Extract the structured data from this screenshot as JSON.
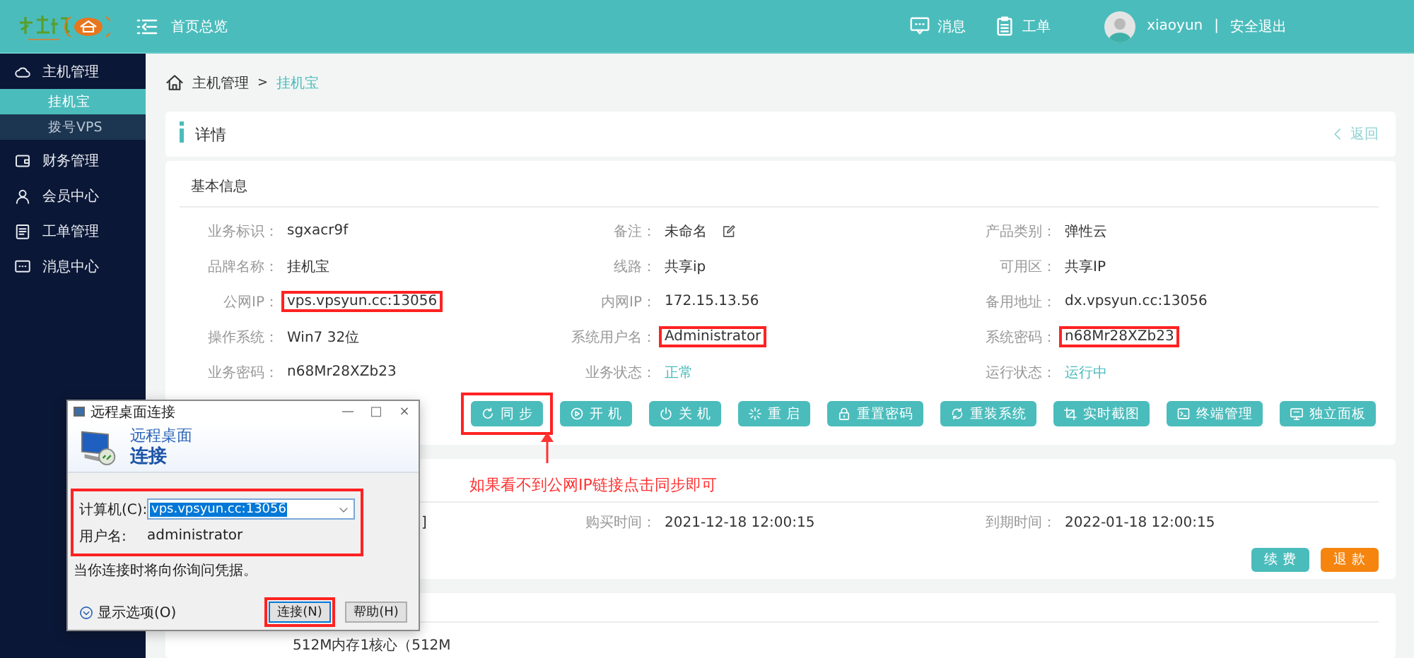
{
  "header": {
    "page_title": "首页总览",
    "links": [
      {
        "label": "消息"
      },
      {
        "label": "工单"
      }
    ],
    "user": "xiaoyun",
    "separator": "|",
    "logout": "安全退出"
  },
  "sidebar": {
    "items": [
      {
        "label": "主机管理",
        "children": [
          {
            "label": "挂机宝",
            "selected": true
          },
          {
            "label": "拨号VPS",
            "selected": false
          }
        ]
      },
      {
        "label": "财务管理"
      },
      {
        "label": "会员中心"
      },
      {
        "label": "工单管理"
      },
      {
        "label": "消息中心"
      }
    ]
  },
  "breadcrumb": {
    "items": [
      "主机管理",
      "挂机宝"
    ],
    "separator": ">"
  },
  "detail_header": {
    "title": "详情",
    "back": "返回"
  },
  "info": {
    "section_title": "基本信息",
    "fields": [
      {
        "label": "业务标识：",
        "value": "sgxacr9f",
        "kind": "text",
        "highlighted": false
      },
      {
        "label": "备注：",
        "value": "未命名",
        "kind": "editable",
        "highlighted": false
      },
      {
        "label": "产品类别：",
        "value": "弹性云",
        "kind": "text",
        "highlighted": false
      },
      {
        "label": "品牌名称：",
        "value": "挂机宝",
        "kind": "text",
        "highlighted": false
      },
      {
        "label": "线路：",
        "value": "共享ip",
        "kind": "text",
        "highlighted": false
      },
      {
        "label": "可用区：",
        "value": "共享IP",
        "kind": "text",
        "highlighted": false
      },
      {
        "label": "公网IP：",
        "value": "vps.vpsyun.cc:13056",
        "kind": "text",
        "highlighted": true
      },
      {
        "label": "内网IP：",
        "value": "172.15.13.56",
        "kind": "text",
        "highlighted": false
      },
      {
        "label": "备用地址：",
        "value": "dx.vpsyun.cc:13056",
        "kind": "text",
        "highlighted": false
      },
      {
        "label": "操作系统：",
        "value": "Win7 32位",
        "kind": "text",
        "highlighted": false
      },
      {
        "label": "系统用户名：",
        "value": "Administrator",
        "kind": "text",
        "highlighted": true
      },
      {
        "label": "系统密码：",
        "value": "n68Mr28XZb23",
        "kind": "text",
        "highlighted": true
      },
      {
        "label": "业务密码：",
        "value": "n68Mr28XZb23",
        "kind": "text",
        "highlighted": false
      },
      {
        "label": "业务状态：",
        "value": "正常",
        "kind": "status",
        "highlighted": false
      },
      {
        "label": "运行状态：",
        "value": "运行中",
        "kind": "status",
        "highlighted": false
      }
    ],
    "actions": [
      {
        "label": "同 步",
        "highlighted": true
      },
      {
        "label": "开 机",
        "highlighted": false
      },
      {
        "label": "关 机",
        "highlighted": false
      },
      {
        "label": "重 启",
        "highlighted": false
      },
      {
        "label": "重置密码",
        "highlighted": false
      },
      {
        "label": "重装系统",
        "highlighted": false
      },
      {
        "label": "实时截图",
        "highlighted": false
      },
      {
        "label": "终端管理",
        "highlighted": false
      },
      {
        "label": "独立面板",
        "highlighted": false
      }
    ]
  },
  "annotation": {
    "text": "如果看不到公网IP链接点击同步即可"
  },
  "order": {
    "column_1_value": "]",
    "fields": [
      {
        "label": "购买时间：",
        "value": "2021-12-18 12:00:15"
      },
      {
        "label": "到期时间：",
        "value": "2022-01-18 12:00:15"
      }
    ],
    "buttons": [
      {
        "label": "续 费",
        "kind": "primary"
      },
      {
        "label": "退 款",
        "kind": "danger"
      }
    ]
  },
  "plan": {
    "text": "512M内存1核心（512M"
  },
  "dialog": {
    "title": "远程桌面连接",
    "controls": [
      "—",
      "□",
      "×"
    ],
    "heading_top": "远程桌面",
    "heading_bottom": "连接",
    "fields_highlighted": true,
    "computer_label": "计算机(C):",
    "computer_value": "vps.vpsyun.cc:13056",
    "computer_value_selected": true,
    "user_label": "用户名:",
    "user_value": "administrator",
    "note": "当你连接时将向你询问凭据。",
    "options": "显示选项(O)",
    "buttons": [
      {
        "label": "连接(N)",
        "highlighted": true
      },
      {
        "label": "帮助(H)",
        "highlighted": false
      }
    ]
  }
}
